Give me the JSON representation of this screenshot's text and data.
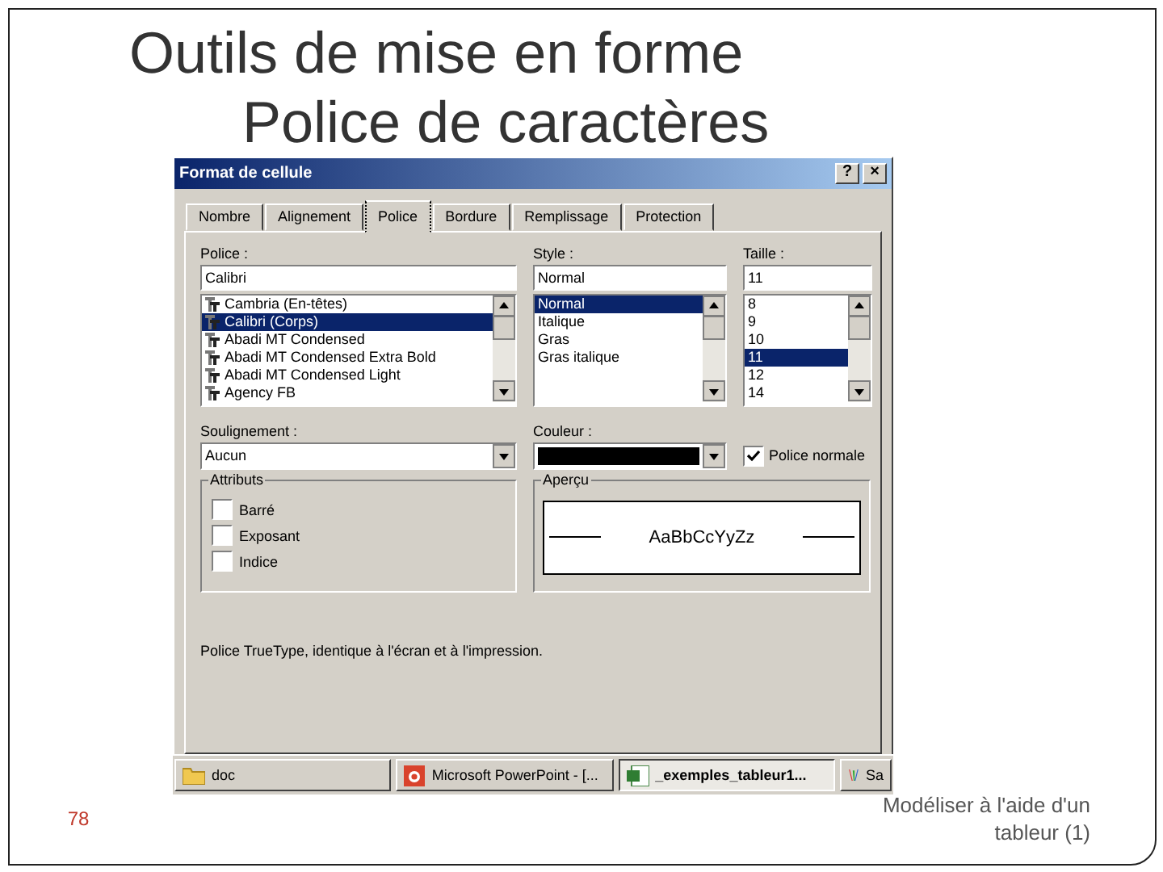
{
  "slide": {
    "title": "Outils de mise en forme",
    "subtitle": "Police de caractères",
    "page_number": "78",
    "footer": "Modéliser à l'aide d'un tableur (1)"
  },
  "dialog": {
    "title": "Format de cellule",
    "help_button": "?",
    "close_button": "×",
    "tabs": [
      {
        "label": "Nombre",
        "selected": false
      },
      {
        "label": "Alignement",
        "selected": false
      },
      {
        "label": "Police",
        "selected": true
      },
      {
        "label": "Bordure",
        "selected": false
      },
      {
        "label": "Remplissage",
        "selected": false
      },
      {
        "label": "Protection",
        "selected": false
      }
    ],
    "font": {
      "label": "Police :",
      "value": "Calibri",
      "items": [
        {
          "label": "Cambria (En-têtes)",
          "selected": false
        },
        {
          "label": "Calibri (Corps)",
          "selected": true
        },
        {
          "label": "Abadi MT Condensed",
          "selected": false
        },
        {
          "label": "Abadi MT Condensed Extra Bold",
          "selected": false
        },
        {
          "label": "Abadi MT Condensed Light",
          "selected": false
        },
        {
          "label": "Agency FB",
          "selected": false
        }
      ]
    },
    "style": {
      "label": "Style :",
      "value": "Normal",
      "items": [
        {
          "label": "Normal",
          "selected": true
        },
        {
          "label": "Italique",
          "selected": false
        },
        {
          "label": "Gras",
          "selected": false
        },
        {
          "label": "Gras italique",
          "selected": false
        }
      ]
    },
    "size": {
      "label": "Taille :",
      "value": "11",
      "items": [
        {
          "label": "8",
          "selected": false
        },
        {
          "label": "9",
          "selected": false
        },
        {
          "label": "10",
          "selected": false
        },
        {
          "label": "11",
          "selected": true
        },
        {
          "label": "12",
          "selected": false
        },
        {
          "label": "14",
          "selected": false
        }
      ]
    },
    "underline": {
      "label": "Soulignement :",
      "value": "Aucun"
    },
    "color": {
      "label": "Couleur :",
      "color": "#000000"
    },
    "normal_font": {
      "label": "Police normale",
      "checked": true
    },
    "attributes": {
      "title": "Attributs",
      "items": [
        {
          "label": "Barré",
          "checked": false
        },
        {
          "label": "Exposant",
          "checked": false
        },
        {
          "label": "Indice",
          "checked": false
        }
      ]
    },
    "preview": {
      "title": "Aperçu",
      "sample": "AaBbCcYyZz"
    },
    "note": "Police TrueType, identique à l'écran et à l'impression."
  },
  "taskbar": [
    {
      "label": "doc",
      "kind": "folder",
      "selected": false
    },
    {
      "label": "Microsoft PowerPoint - [...",
      "kind": "powerpoint",
      "selected": false
    },
    {
      "label": "_exemples_tableur1...",
      "kind": "excel",
      "selected": true
    },
    {
      "label": "Sa",
      "kind": "app",
      "selected": false
    }
  ]
}
